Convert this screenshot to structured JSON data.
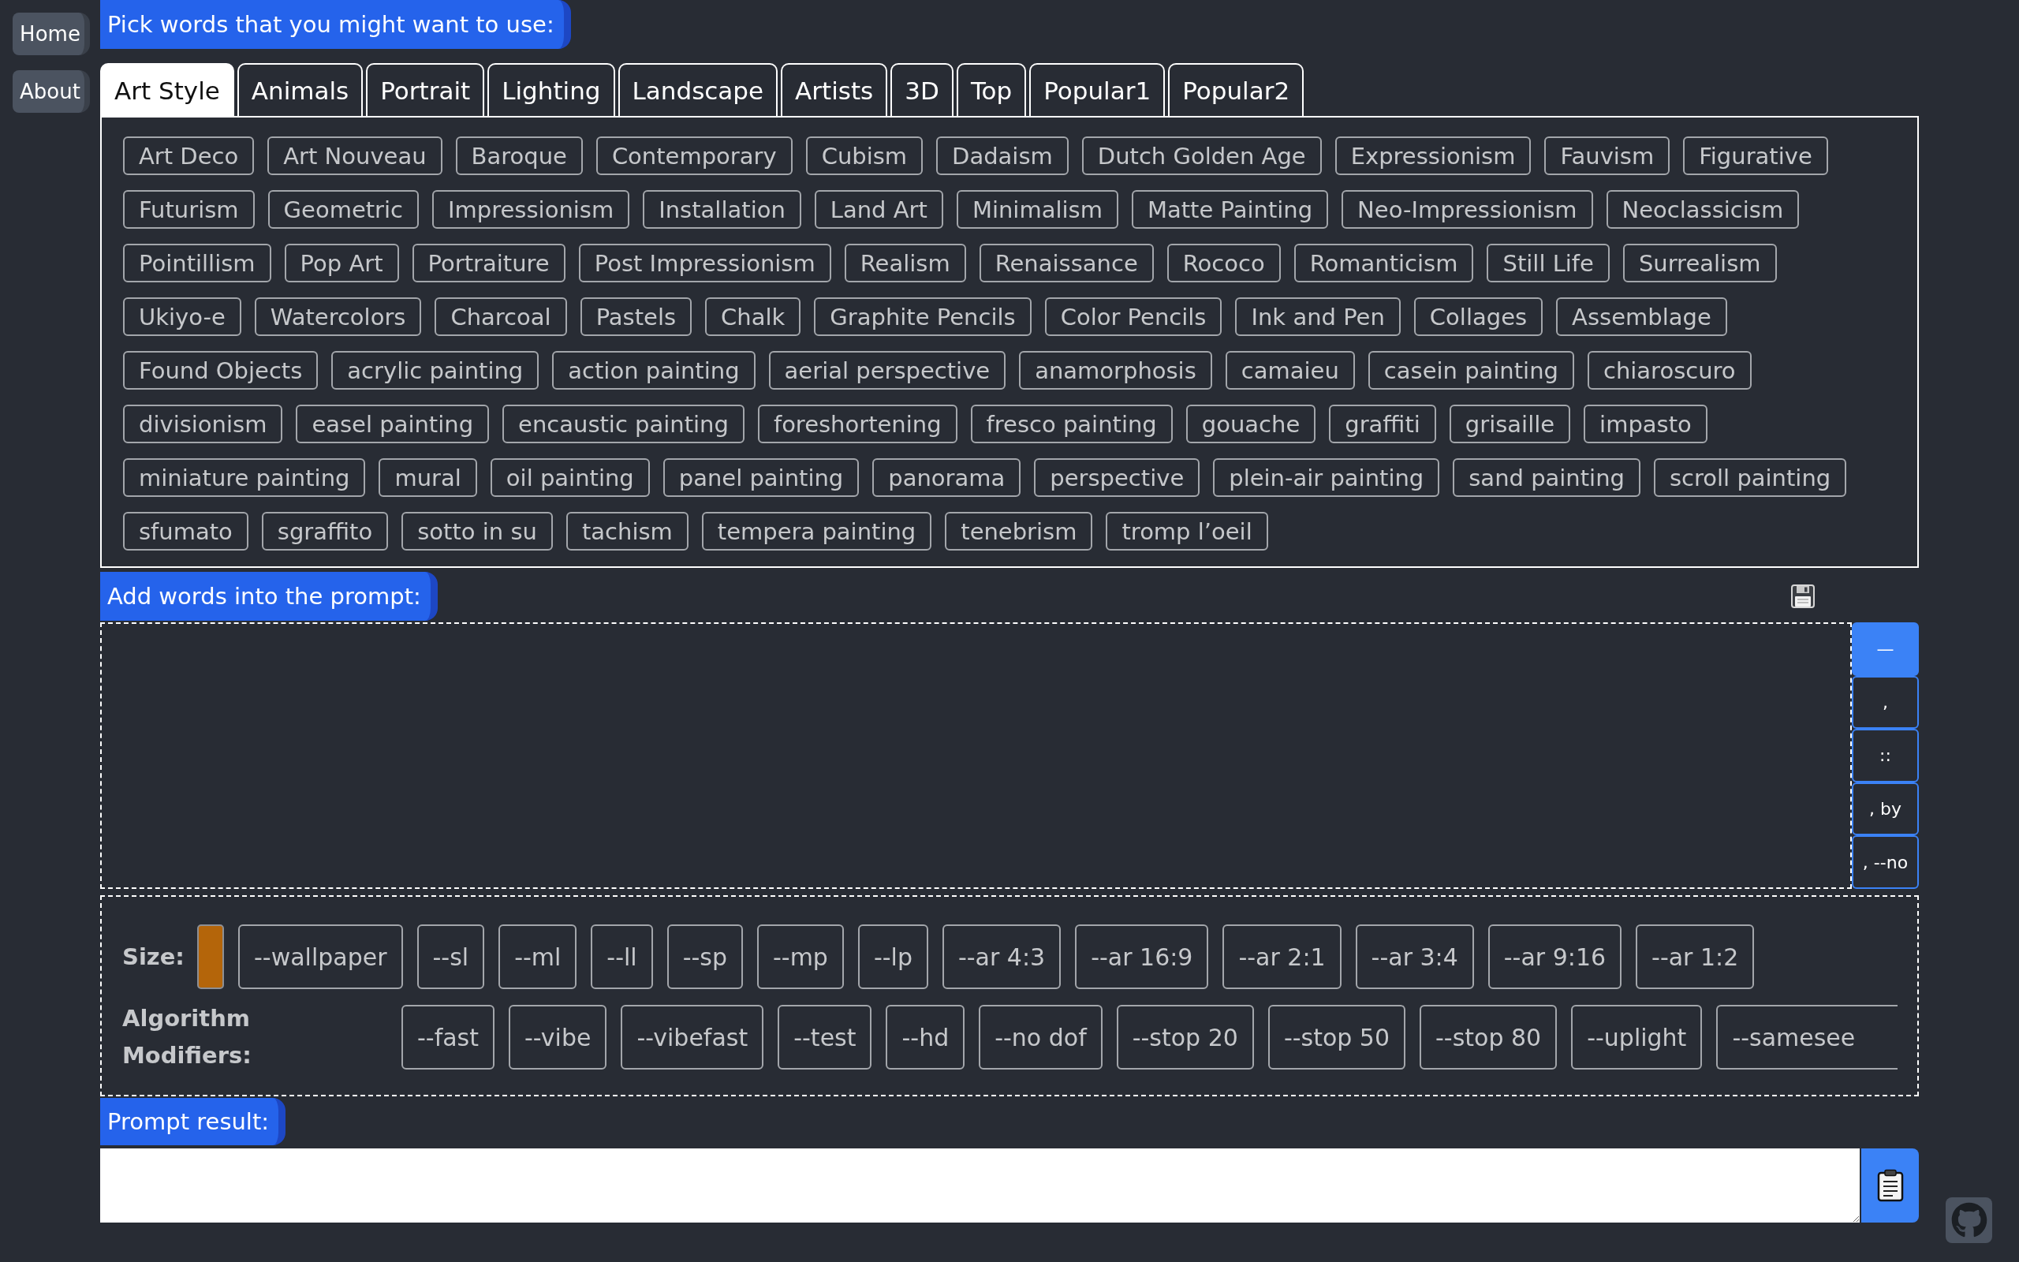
{
  "nav": [
    "Home",
    "About"
  ],
  "pick_section": {
    "heading": "Pick words that you might want to use:",
    "tabs": [
      {
        "label": "Art Style",
        "selected": true
      },
      {
        "label": "Animals",
        "selected": false
      },
      {
        "label": "Portrait",
        "selected": false
      },
      {
        "label": "Lighting",
        "selected": false
      },
      {
        "label": "Landscape",
        "selected": false
      },
      {
        "label": "Artists",
        "selected": false
      },
      {
        "label": "3D",
        "selected": false
      },
      {
        "label": "Top",
        "selected": false
      },
      {
        "label": "Popular1",
        "selected": false
      },
      {
        "label": "Popular2",
        "selected": false
      }
    ],
    "tag_rows": [
      [
        "Art Deco",
        "Art Nouveau",
        "Baroque",
        "Contemporary",
        "Cubism",
        "Dadaism",
        "Dutch Golden Age",
        "Expressionism",
        "Fauvism",
        "Figurative"
      ],
      [
        "Futurism",
        "Geometric",
        "Impressionism",
        "Installation",
        "Land Art",
        "Minimalism",
        "Matte Painting",
        "Neo-Impressionism",
        "Neoclassicism"
      ],
      [
        "Pointillism",
        "Pop Art",
        "Portraiture",
        "Post Impressionism",
        "Realism",
        "Renaissance",
        "Rococo",
        "Romanticism",
        "Still Life",
        "Surrealism"
      ],
      [
        "Ukiyo-e",
        "Watercolors",
        "Charcoal",
        "Pastels",
        "Chalk",
        "Graphite Pencils",
        "Color Pencils",
        "Ink and Pen",
        "Collages",
        "Assemblage"
      ],
      [
        "Found Objects",
        "acrylic painting",
        "action painting",
        "aerial perspective",
        "anamorphosis",
        "camaieu",
        "casein painting",
        "chiaroscuro"
      ],
      [
        "divisionism",
        "easel painting",
        "encaustic painting",
        "foreshortening",
        "fresco painting",
        "gouache",
        "graffiti",
        "grisaille",
        "impasto"
      ],
      [
        "miniature painting",
        "mural",
        "oil painting",
        "panel painting",
        "panorama",
        "perspective",
        "plein-air painting",
        "sand painting",
        "scroll painting"
      ],
      [
        "sfumato",
        "sgraffito",
        "sotto in su",
        "tachism",
        "tempera painting",
        "tenebrism",
        "tromp l’oeil"
      ]
    ]
  },
  "prompt_section": {
    "heading": "Add words into the prompt:",
    "separators": [
      {
        "label": "—",
        "selected": true
      },
      {
        "label": ",",
        "selected": false
      },
      {
        "label": "::",
        "selected": false
      },
      {
        "label": ", by",
        "selected": false
      },
      {
        "label": ", --no",
        "selected": false
      }
    ]
  },
  "options": {
    "size_label": "Size:",
    "size_options": [
      "--wallpaper",
      "--sl",
      "--ml",
      "--ll",
      "--sp",
      "--mp",
      "--lp",
      "--ar 4:3",
      "--ar 16:9",
      "--ar 2:1",
      "--ar 3:4",
      "--ar 9:16",
      "--ar 1:2"
    ],
    "modifiers_label": "Algorithm Modifiers:",
    "modifiers": [
      "--fast",
      "--vibe",
      "--vibefast",
      "--test",
      "--hd",
      "--no dof",
      "--stop 20",
      "--stop 50",
      "--stop 80",
      "--uplight",
      "--samesee"
    ]
  },
  "result_section": {
    "heading": "Prompt result:"
  }
}
